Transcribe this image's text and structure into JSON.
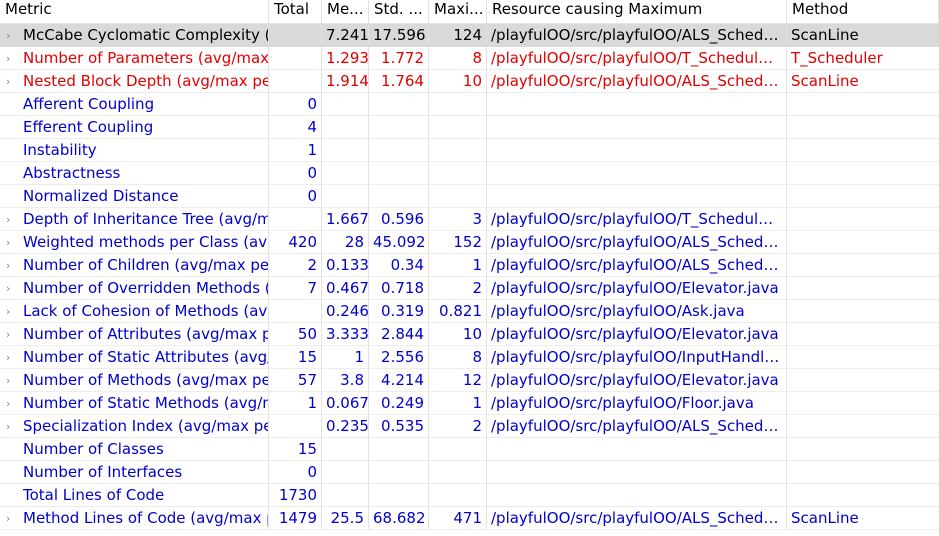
{
  "columns": {
    "metric": "Metric",
    "total": "Total",
    "mean": "Me...",
    "std": "Std. ...",
    "max": "Maxi...",
    "resource": "Resource causing Maximum",
    "method": "Method"
  },
  "rows": [
    {
      "metric": "McCabe Cyclomatic Complexity (avg/max per method)",
      "total": "",
      "mean": "7.241",
      "std": "17.596",
      "max": "124",
      "resource": "/playfulOO/src/playfulOO/ALS_Schedu...",
      "method": "ScanLine",
      "expandable": true,
      "style": "selected"
    },
    {
      "metric": "Number of Parameters (avg/max per method)",
      "total": "",
      "mean": "1.293",
      "std": "1.772",
      "max": "8",
      "resource": "/playfulOO/src/playfulOO/T_Scheduler...",
      "method": "T_Scheduler",
      "expandable": true,
      "style": "red"
    },
    {
      "metric": "Nested Block Depth (avg/max per method)",
      "total": "",
      "mean": "1.914",
      "std": "1.764",
      "max": "10",
      "resource": "/playfulOO/src/playfulOO/ALS_Schedu...",
      "method": "ScanLine",
      "expandable": true,
      "style": "red"
    },
    {
      "metric": "Afferent Coupling",
      "total": "0",
      "mean": "",
      "std": "",
      "max": "",
      "resource": "",
      "method": "",
      "expandable": false,
      "style": "blue"
    },
    {
      "metric": "Efferent Coupling",
      "total": "4",
      "mean": "",
      "std": "",
      "max": "",
      "resource": "",
      "method": "",
      "expandable": false,
      "style": "blue"
    },
    {
      "metric": "Instability",
      "total": "1",
      "mean": "",
      "std": "",
      "max": "",
      "resource": "",
      "method": "",
      "expandable": false,
      "style": "blue"
    },
    {
      "metric": "Abstractness",
      "total": "0",
      "mean": "",
      "std": "",
      "max": "",
      "resource": "",
      "method": "",
      "expandable": false,
      "style": "blue"
    },
    {
      "metric": "Normalized Distance",
      "total": "0",
      "mean": "",
      "std": "",
      "max": "",
      "resource": "",
      "method": "",
      "expandable": false,
      "style": "blue"
    },
    {
      "metric": "Depth of Inheritance Tree (avg/max per type)",
      "total": "",
      "mean": "1.667",
      "std": "0.596",
      "max": "3",
      "resource": "/playfulOO/src/playfulOO/T_Scheduler...",
      "method": "",
      "expandable": true,
      "style": "blue"
    },
    {
      "metric": "Weighted methods per Class (avg/max per type)",
      "total": "420",
      "mean": "28",
      "std": "45.092",
      "max": "152",
      "resource": "/playfulOO/src/playfulOO/ALS_Schedu...",
      "method": "",
      "expandable": true,
      "style": "blue"
    },
    {
      "metric": "Number of Children (avg/max per type)",
      "total": "2",
      "mean": "0.133",
      "std": "0.34",
      "max": "1",
      "resource": "/playfulOO/src/playfulOO/ALS_Schedu...",
      "method": "",
      "expandable": true,
      "style": "blue"
    },
    {
      "metric": "Number of Overridden Methods (avg/max per type)",
      "total": "7",
      "mean": "0.467",
      "std": "0.718",
      "max": "2",
      "resource": "/playfulOO/src/playfulOO/Elevator.java",
      "method": "",
      "expandable": true,
      "style": "blue"
    },
    {
      "metric": "Lack of Cohesion of Methods (avg/max per type)",
      "total": "",
      "mean": "0.246",
      "std": "0.319",
      "max": "0.821",
      "resource": "/playfulOO/src/playfulOO/Ask.java",
      "method": "",
      "expandable": true,
      "style": "blue"
    },
    {
      "metric": "Number of Attributes (avg/max per type)",
      "total": "50",
      "mean": "3.333",
      "std": "2.844",
      "max": "10",
      "resource": "/playfulOO/src/playfulOO/Elevator.java",
      "method": "",
      "expandable": true,
      "style": "blue"
    },
    {
      "metric": "Number of Static Attributes (avg/max per type)",
      "total": "15",
      "mean": "1",
      "std": "2.556",
      "max": "8",
      "resource": "/playfulOO/src/playfulOO/InputHandle...",
      "method": "",
      "expandable": true,
      "style": "blue"
    },
    {
      "metric": "Number of Methods (avg/max per type)",
      "total": "57",
      "mean": "3.8",
      "std": "4.214",
      "max": "12",
      "resource": "/playfulOO/src/playfulOO/Elevator.java",
      "method": "",
      "expandable": true,
      "style": "blue"
    },
    {
      "metric": "Number of Static Methods (avg/max per type)",
      "total": "1",
      "mean": "0.067",
      "std": "0.249",
      "max": "1",
      "resource": "/playfulOO/src/playfulOO/Floor.java",
      "method": "",
      "expandable": true,
      "style": "blue"
    },
    {
      "metric": "Specialization Index (avg/max per type)",
      "total": "",
      "mean": "0.235",
      "std": "0.535",
      "max": "2",
      "resource": "/playfulOO/src/playfulOO/ALS_Schedu...",
      "method": "",
      "expandable": true,
      "style": "blue"
    },
    {
      "metric": "Number of Classes",
      "total": "15",
      "mean": "",
      "std": "",
      "max": "",
      "resource": "",
      "method": "",
      "expandable": false,
      "style": "blue"
    },
    {
      "metric": "Number of Interfaces",
      "total": "0",
      "mean": "",
      "std": "",
      "max": "",
      "resource": "",
      "method": "",
      "expandable": false,
      "style": "blue"
    },
    {
      "metric": "Total Lines of Code",
      "total": "1730",
      "mean": "",
      "std": "",
      "max": "",
      "resource": "",
      "method": "",
      "expandable": false,
      "style": "blue"
    },
    {
      "metric": "Method Lines of Code (avg/max per method)",
      "total": "1479",
      "mean": "25.5",
      "std": "68.682",
      "max": "471",
      "resource": "/playfulOO/src/playfulOO/ALS_Schedu...",
      "method": "ScanLine",
      "expandable": true,
      "style": "blue"
    }
  ]
}
